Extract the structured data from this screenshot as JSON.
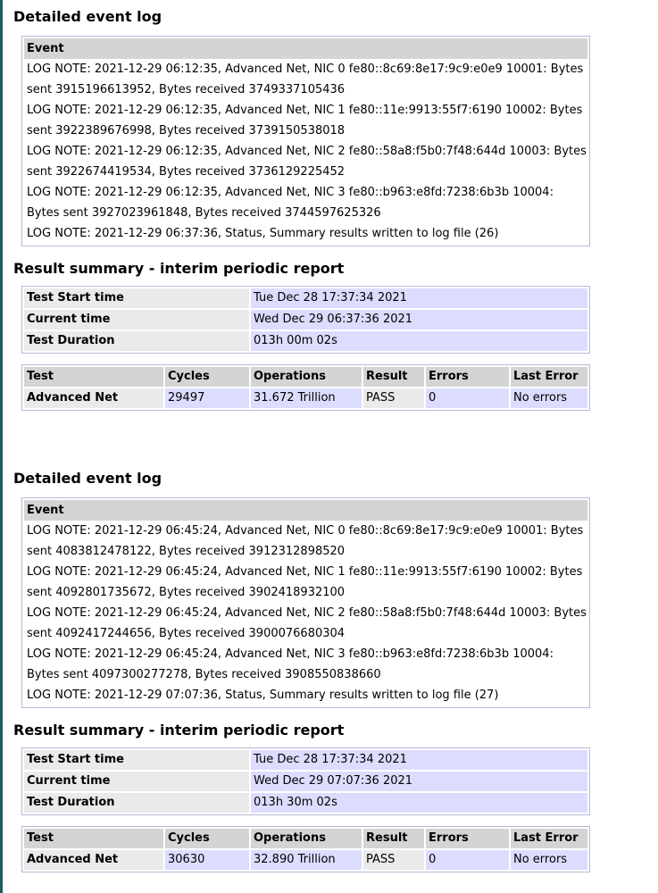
{
  "log_header": "Event",
  "summary_heading": "Result summary - interim periodic report",
  "event_log_heading": "Detailed event log",
  "sections": [
    {
      "events": [
        "LOG NOTE: 2021-12-29 06:12:35, Advanced Net, NIC 0 fe80::8c69:8e17:9c9:e0e9 10001: Bytes sent 3915196613952, Bytes received 3749337105436",
        "LOG NOTE: 2021-12-29 06:12:35, Advanced Net, NIC 1 fe80::11e:9913:55f7:6190 10002: Bytes sent 3922389676998, Bytes received 3739150538018",
        "LOG NOTE: 2021-12-29 06:12:35, Advanced Net, NIC 2 fe80::58a8:f5b0:7f48:644d 10003: Bytes sent 3922674419534, Bytes received 3736129225452",
        "LOG NOTE: 2021-12-29 06:12:35, Advanced Net, NIC 3 fe80::b963:e8fd:7238:6b3b 10004: Bytes sent 3927023961848, Bytes received 3744597625326",
        "LOG NOTE: 2021-12-29 06:37:36, Status, Summary results written to log file (26)"
      ],
      "summary": {
        "test_start_label": "Test Start time",
        "test_start": "Tue Dec 28 17:37:34 2021",
        "current_label": "Current time",
        "current": "Wed Dec 29 06:37:36 2021",
        "duration_label": "Test Duration",
        "duration": "013h 00m 02s"
      },
      "results": {
        "headers": [
          "Test",
          "Cycles",
          "Operations",
          "Result",
          "Errors",
          "Last Error"
        ],
        "row": [
          "Advanced Net",
          "29497",
          "31.672 Trillion",
          "PASS",
          "0",
          "No errors"
        ]
      }
    },
    {
      "events": [
        "LOG NOTE: 2021-12-29 06:45:24, Advanced Net, NIC 0 fe80::8c69:8e17:9c9:e0e9 10001: Bytes sent 4083812478122, Bytes received 3912312898520",
        "LOG NOTE: 2021-12-29 06:45:24, Advanced Net, NIC 1 fe80::11e:9913:55f7:6190 10002: Bytes sent 4092801735672, Bytes received 3902418932100",
        "LOG NOTE: 2021-12-29 06:45:24, Advanced Net, NIC 2 fe80::58a8:f5b0:7f48:644d 10003: Bytes sent 4092417244656, Bytes received 3900076680304",
        "LOG NOTE: 2021-12-29 06:45:24, Advanced Net, NIC 3 fe80::b963:e8fd:7238:6b3b 10004: Bytes sent 4097300277278, Bytes received 3908550838660",
        "LOG NOTE: 2021-12-29 07:07:36, Status, Summary results written to log file (27)"
      ],
      "summary": {
        "test_start_label": "Test Start time",
        "test_start": "Tue Dec 28 17:37:34 2021",
        "current_label": "Current time",
        "current": "Wed Dec 29 07:07:36 2021",
        "duration_label": "Test Duration",
        "duration": "013h 30m 02s"
      },
      "results": {
        "headers": [
          "Test",
          "Cycles",
          "Operations",
          "Result",
          "Errors",
          "Last Error"
        ],
        "row": [
          "Advanced Net",
          "30630",
          "32.890 Trillion",
          "PASS",
          "0",
          "No errors"
        ]
      }
    }
  ]
}
